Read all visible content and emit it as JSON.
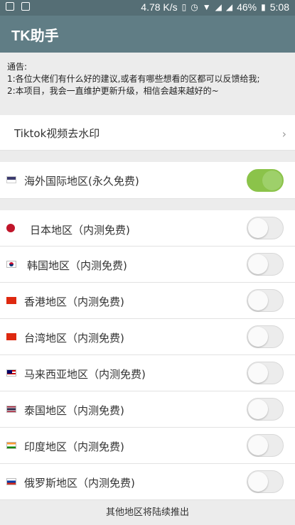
{
  "status_bar": {
    "speed": "4.78 K/s",
    "battery": "46%",
    "time": "5:08"
  },
  "app_bar": {
    "title": "TK助手"
  },
  "notice": {
    "heading": "通告:",
    "line1": "1:各位大佬们有什么好的建议,或者有哪些想看的区都可以反馈给我;",
    "line2": "2:本项目，我会一直维护更新升级，相信会越来越好的~"
  },
  "watermark_row": {
    "label": "Tiktok视频去水印"
  },
  "regions": [
    {
      "label": "海外国际地区(永久免费)",
      "on": true,
      "flag": "us-flag-icon"
    },
    {
      "label": "日本地区（内测免费)",
      "on": false,
      "flag": "japan-flag-icon"
    },
    {
      "label": "韩国地区（内测免费)",
      "on": false,
      "flag": "korea-flag-icon"
    },
    {
      "label": "香港地区（内测免费)",
      "on": false,
      "flag": "hongkong-flag-icon"
    },
    {
      "label": "台湾地区（内测免费)",
      "on": false,
      "flag": "taiwan-flag-icon"
    },
    {
      "label": "马来西亚地区（内测免费)",
      "on": false,
      "flag": "malaysia-flag-icon"
    },
    {
      "label": "泰国地区（内测免费)",
      "on": false,
      "flag": "thailand-flag-icon"
    },
    {
      "label": "印度地区（内测免费)",
      "on": false,
      "flag": "india-flag-icon"
    },
    {
      "label": "俄罗斯地区（内测免费)",
      "on": false,
      "flag": "russia-flag-icon"
    }
  ],
  "footer": {
    "text": "其他地区将陆续推出"
  },
  "colors": {
    "app_bar": "#607d85",
    "switch_on": "#8bc34a"
  }
}
